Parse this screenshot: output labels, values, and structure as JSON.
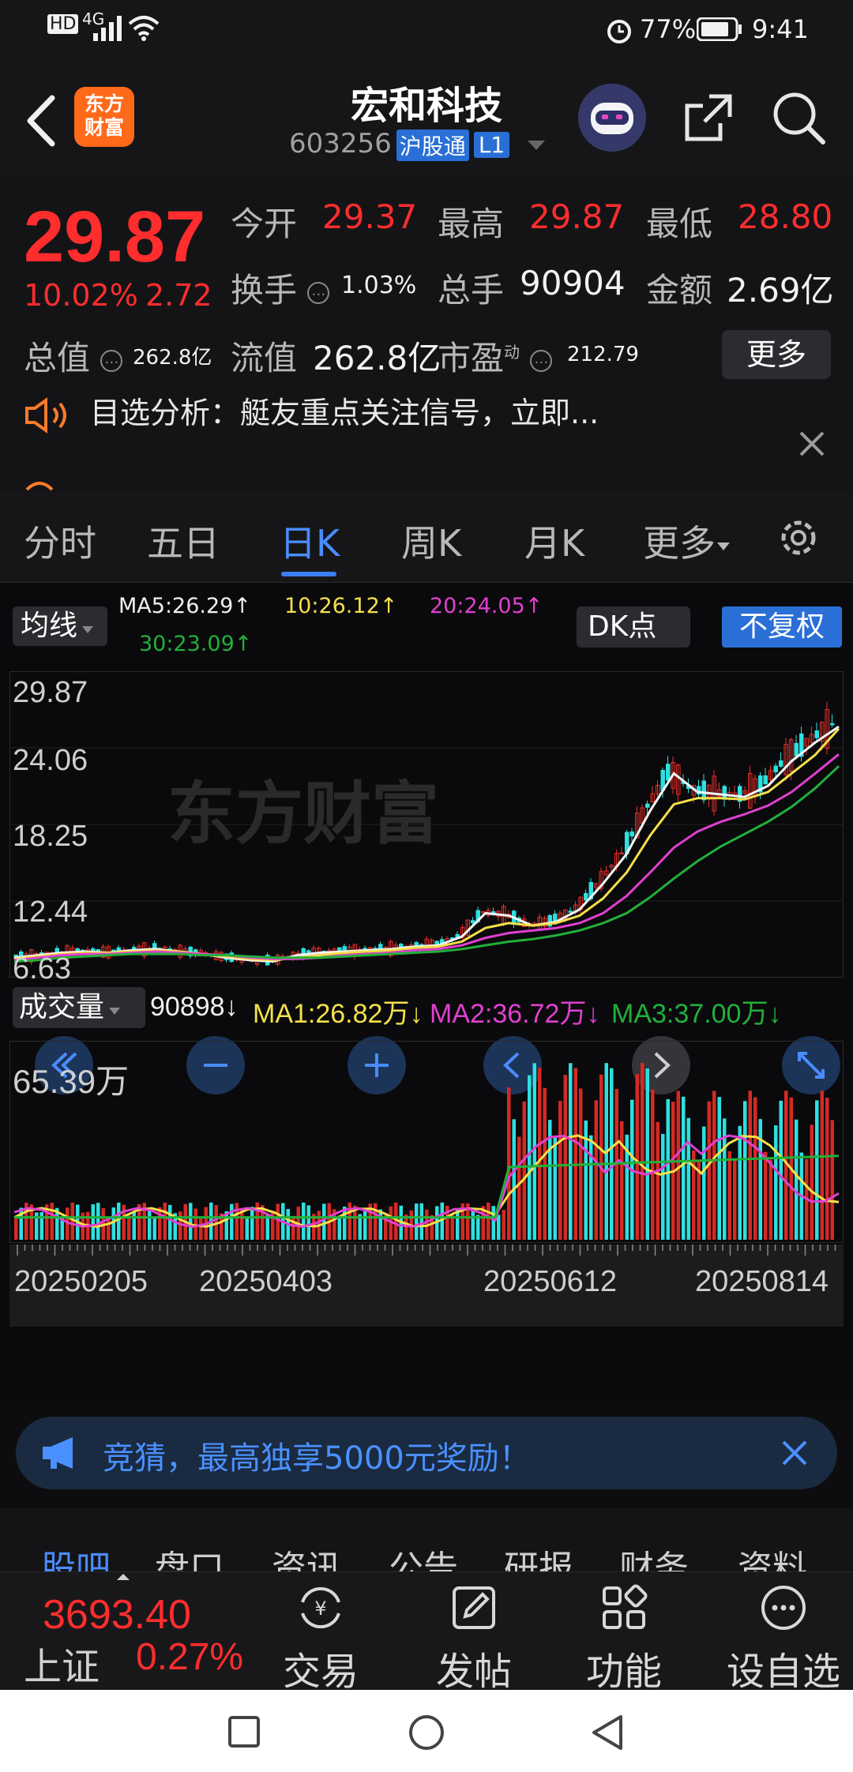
{
  "status": {
    "time": "9:41",
    "battery": "77%",
    "network": "4G"
  },
  "header": {
    "logo_line1": "东方",
    "logo_line2": "财富",
    "stock_name": "宏和科技",
    "stock_code": "603256",
    "connect_badge": "沪股通",
    "level_badge": "L1"
  },
  "quote": {
    "last_price": "29.87",
    "pct_change": "10.02%",
    "abs_change": "2.72",
    "open_label": "今开",
    "open": "29.37",
    "high_label": "最高",
    "high": "29.87",
    "low_label": "最低",
    "low": "28.80",
    "turnover_label": "换手",
    "turnover": "1.03%",
    "volume_label": "总手",
    "volume": "90904",
    "amount_label": "金额",
    "amount": "2.69亿",
    "mktcap_label": "总值",
    "mktcap": "262.8亿",
    "float_label": "流值",
    "float_cap": "262.8亿",
    "pe_label": "市盈",
    "pe_sup": "动",
    "pe": "212.79",
    "more_label": "更多",
    "analysis_text": "目选分析：艇友重点关注信号，立即..."
  },
  "period_tabs": [
    "分时",
    "五日",
    "日K",
    "周K",
    "月K",
    "更多"
  ],
  "active_period": "日K",
  "chart": {
    "ma_dropdown": "均线",
    "ma5": "MA5:26.29↑",
    "ma10": "10:26.12↑",
    "ma20": "20:24.05↑",
    "ma30": "30:23.09↑",
    "dk_label": "DK点",
    "adjust_label": "不复权",
    "price_ticks": [
      "29.87",
      "24.06",
      "18.25",
      "12.44",
      "6.63"
    ],
    "watermark": "东方财富",
    "vol_dropdown": "成交量",
    "vol_value": "90898↓",
    "vol_ma1": "MA1:26.82万↓",
    "vol_ma2": "MA2:36.72万↓",
    "vol_ma3": "MA3:37.00万↓",
    "vol_top": "65.39万",
    "dates": [
      "20250205",
      "20250403",
      "20250612",
      "20250814"
    ]
  },
  "chart_data": {
    "type": "line",
    "ylim": [
      6.63,
      29.87
    ],
    "series": [
      {
        "name": "MA5",
        "values": [
          7.6,
          7.8,
          8.0,
          8.1,
          8.0,
          8.2,
          8.3,
          8.1,
          7.9,
          7.6,
          7.4,
          7.3,
          7.8,
          8.0,
          8.1,
          8.2,
          8.3,
          8.5,
          8.6,
          9.3,
          11.2,
          11.0,
          10.2,
          10.5,
          11.5,
          13.6,
          16.0,
          19.5,
          22.5,
          21.0,
          20.8,
          20.6,
          21.5,
          23.5,
          25.0,
          26.29
        ]
      },
      {
        "name": "MA10",
        "values": [
          7.5,
          7.7,
          7.9,
          8.0,
          8.0,
          8.1,
          8.2,
          8.1,
          7.9,
          7.7,
          7.5,
          7.4,
          7.6,
          7.8,
          8.0,
          8.1,
          8.2,
          8.4,
          8.5,
          8.9,
          10.0,
          10.4,
          10.2,
          10.4,
          11.0,
          12.4,
          14.5,
          17.5,
          20.0,
          20.5,
          20.5,
          20.4,
          21.0,
          22.5,
          24.0,
          26.12
        ]
      },
      {
        "name": "MA20",
        "values": [
          7.4,
          7.6,
          7.8,
          7.9,
          7.9,
          8.0,
          8.1,
          8.0,
          7.9,
          7.8,
          7.6,
          7.5,
          7.5,
          7.6,
          7.8,
          7.9,
          8.0,
          8.2,
          8.3,
          8.6,
          9.2,
          9.6,
          9.8,
          10.0,
          10.4,
          11.2,
          12.6,
          14.5,
          16.5,
          17.8,
          18.6,
          19.2,
          19.9,
          21.0,
          22.5,
          24.05
        ]
      },
      {
        "name": "MA30",
        "values": [
          7.3,
          7.4,
          7.6,
          7.7,
          7.8,
          7.9,
          7.9,
          7.9,
          7.8,
          7.8,
          7.7,
          7.6,
          7.6,
          7.6,
          7.7,
          7.8,
          7.9,
          8.0,
          8.1,
          8.3,
          8.6,
          8.9,
          9.1,
          9.4,
          9.8,
          10.4,
          11.2,
          12.5,
          14.0,
          15.4,
          16.6,
          17.6,
          18.6,
          19.8,
          21.3,
          23.09
        ]
      }
    ]
  },
  "promo": {
    "text": "竞猜，最高独享5000元奖励！"
  },
  "bottom_tabs": [
    "股吧",
    "盘口",
    "资讯",
    "公告",
    "研报",
    "财务",
    "资料"
  ],
  "index": {
    "value": "3693.40",
    "name": "上证",
    "pct": "0.27%"
  },
  "toolbar": {
    "trade": "交易",
    "post": "发帖",
    "func": "功能",
    "watch": "设自选"
  }
}
